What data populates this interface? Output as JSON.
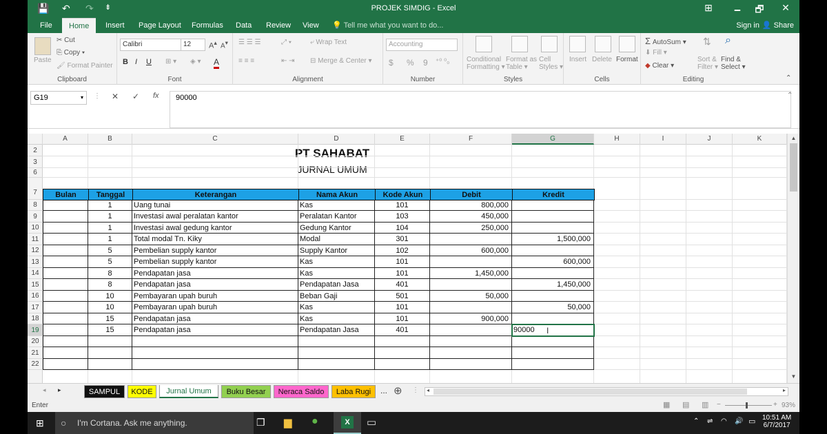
{
  "window": {
    "title": "PROJEK SIMDIG - Excel",
    "qat_save": "💾",
    "qat_undo": "↶",
    "qat_redo": "↷",
    "qat_more": "⇟",
    "min_icon": "🗕",
    "restore_icon": "🗗",
    "close_icon": "✕",
    "ribbon_opts_icon": "⊞"
  },
  "tabs": [
    "File",
    "Home",
    "Insert",
    "Page Layout",
    "Formulas",
    "Data",
    "Review",
    "View"
  ],
  "active_tab": "Home",
  "tellme": "Tell me what you want to do...",
  "signin": "Sign in",
  "share": "Share",
  "ribbon": {
    "clipboard": {
      "paste": "Paste",
      "cut": "Cut",
      "copy": "Copy",
      "format_painter": "Format Painter",
      "label": "Clipboard"
    },
    "font": {
      "name": "Calibri",
      "size": "12",
      "bold": "B",
      "italic": "I",
      "underline": "U",
      "label": "Font"
    },
    "alignment": {
      "wrap": "Wrap Text",
      "merge": "Merge & Center",
      "label": "Alignment"
    },
    "number": {
      "format": "Accounting",
      "dollar": "$",
      "percent": "%",
      "comma": "9",
      "label": "Number"
    },
    "styles": {
      "cond": "Conditional",
      "cond2": "Formatting",
      "fmt_table": "Format as",
      "fmt_table2": "Table",
      "cell_styles": "Cell",
      "cell_styles2": "Styles",
      "label": "Styles"
    },
    "cells": {
      "insert": "Insert",
      "delete": "Delete",
      "format": "Format",
      "label": "Cells"
    },
    "editing": {
      "autosum": "AutoSum",
      "fill": "Fill",
      "clear": "Clear",
      "sort": "Sort &",
      "sort2": "Filter",
      "find": "Find &",
      "find2": "Select",
      "label": "Editing"
    }
  },
  "formula_bar": {
    "name_box": "G19",
    "cancel": "✕",
    "enter": "✓",
    "fx": "fx",
    "content": "90000"
  },
  "columns": [
    "A",
    "B",
    "C",
    "D",
    "E",
    "F",
    "G",
    "H",
    "I",
    "J",
    "K"
  ],
  "rows": [
    "2",
    "3",
    "6",
    "7",
    "8",
    "9",
    "10",
    "11",
    "12",
    "13",
    "14",
    "15",
    "16",
    "17",
    "18",
    "19",
    "20",
    "21",
    "22"
  ],
  "sheet": {
    "company": "PT SAHABAT",
    "subtitle": "JURNAL UMUM",
    "headers": [
      "Bulan",
      "Tanggal",
      "Keterangan",
      "Nama Akun",
      "Kode Akun",
      "Debit",
      "Kredit"
    ],
    "entries": [
      {
        "tanggal": "1",
        "ket": "Uang tunai",
        "akun": "Kas",
        "kode": "101",
        "debit": "800,000",
        "kredit": ""
      },
      {
        "tanggal": "1",
        "ket": "Investasi awal peralatan kantor",
        "akun": "Peralatan Kantor",
        "kode": "103",
        "debit": "450,000",
        "kredit": ""
      },
      {
        "tanggal": "1",
        "ket": "Investasi awal gedung kantor",
        "akun": "Gedung Kantor",
        "kode": "104",
        "debit": "250,000",
        "kredit": ""
      },
      {
        "tanggal": "1",
        "ket": "Total modal Tn. Kiky",
        "akun": "Modal",
        "kode": "301",
        "debit": "",
        "kredit": "1,500,000"
      },
      {
        "tanggal": "5",
        "ket": "Pembelian supply kantor",
        "akun": "Supply Kantor",
        "kode": "102",
        "debit": "600,000",
        "kredit": ""
      },
      {
        "tanggal": "5",
        "ket": "Pembelian supply kantor",
        "akun": "Kas",
        "kode": "101",
        "debit": "",
        "kredit": "600,000"
      },
      {
        "tanggal": "8",
        "ket": "Pendapatan jasa",
        "akun": "Kas",
        "kode": "101",
        "debit": "1,450,000",
        "kredit": ""
      },
      {
        "tanggal": "8",
        "ket": "Pendapatan jasa",
        "akun": "Pendapatan Jasa",
        "kode": "401",
        "debit": "",
        "kredit": "1,450,000"
      },
      {
        "tanggal": "10",
        "ket": "Pembayaran upah buruh",
        "akun": "Beban Gaji",
        "kode": "501",
        "debit": "50,000",
        "kredit": ""
      },
      {
        "tanggal": "10",
        "ket": "Pembayaran upah buruh",
        "akun": "Kas",
        "kode": "101",
        "debit": "",
        "kredit": "50,000"
      },
      {
        "tanggal": "15",
        "ket": "Pendapatan jasa",
        "akun": "Kas",
        "kode": "101",
        "debit": "900,000",
        "kredit": ""
      },
      {
        "tanggal": "15",
        "ket": "Pendapatan jasa",
        "akun": "Pendapatan Jasa",
        "kode": "401",
        "debit": "",
        "kredit": "90000"
      }
    ]
  },
  "sheet_tabs": [
    {
      "name": "SAMPUL",
      "color": "#111111",
      "text": "#ffffff"
    },
    {
      "name": "KODE",
      "color": "#ffff00",
      "text": "#111111"
    },
    {
      "name": "Jurnal Umum",
      "color": "#ffffff",
      "text": "#217346"
    },
    {
      "name": "Buku Besar",
      "color": "#92d050",
      "text": "#111111"
    },
    {
      "name": "Neraca Saldo",
      "color": "#ff66cc",
      "text": "#111111"
    },
    {
      "name": "Laba Rugi",
      "color": "#ffc000",
      "text": "#111111"
    }
  ],
  "sheet_more": "...",
  "add_sheet": "⊕",
  "status": {
    "mode": "Enter",
    "zoom": "93%"
  },
  "taskbar": {
    "cortana": "I'm Cortana. Ask me anything.",
    "time": "10:51 AM",
    "date": "6/7/2017"
  }
}
